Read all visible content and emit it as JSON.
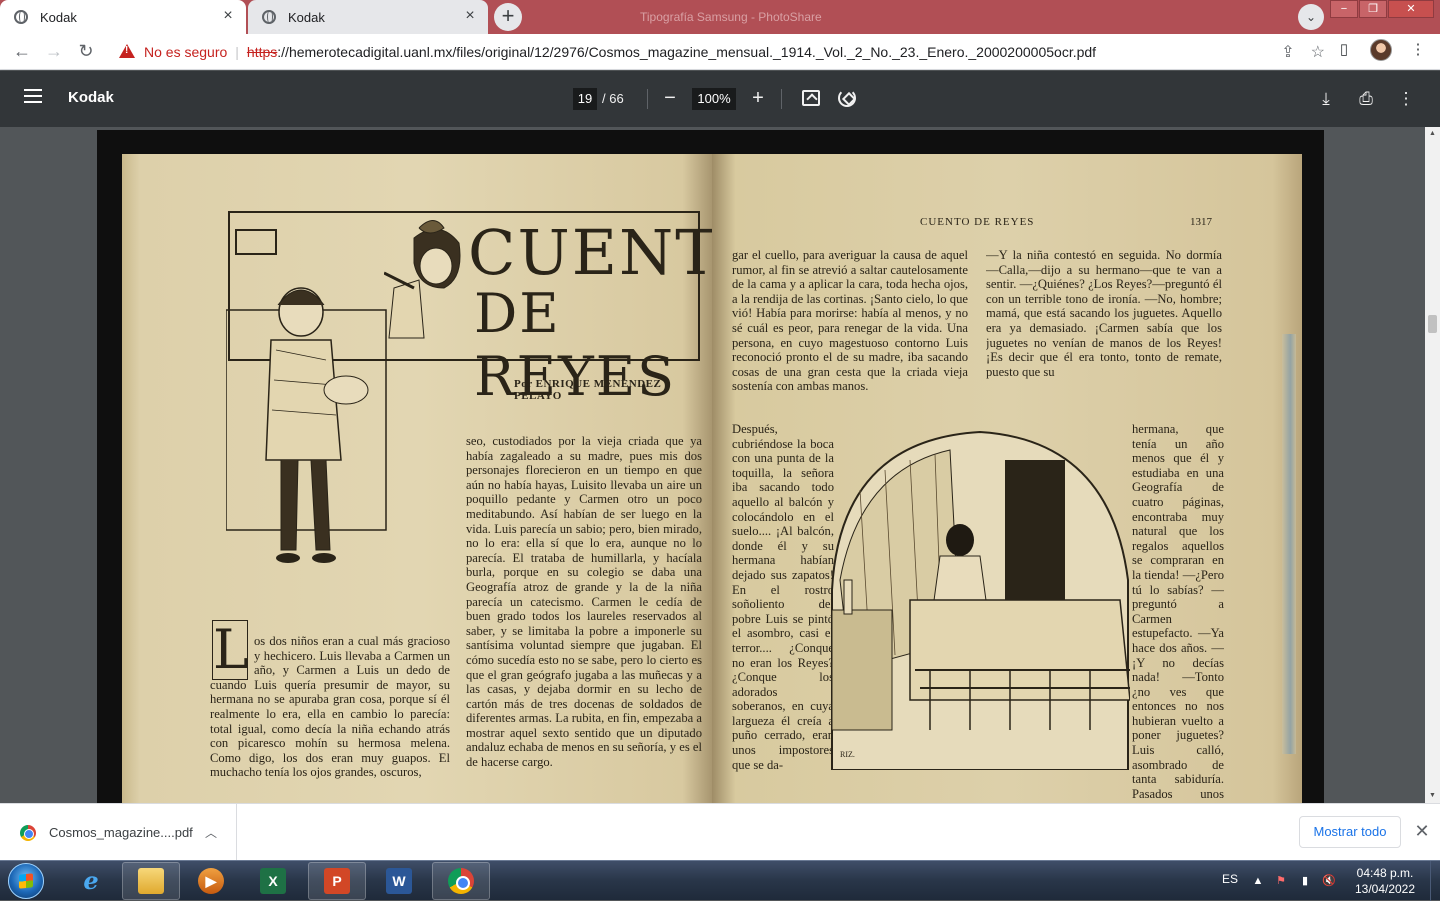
{
  "browser": {
    "tabs": [
      {
        "label": "Kodak",
        "active": true
      },
      {
        "label": "Kodak",
        "active": false
      }
    ],
    "new_tab_label": "+",
    "background_window_title": "Tipografía Samsung - PhotoShare",
    "window_buttons": {
      "minimize": "−",
      "maximize": "❐",
      "close": "✕"
    },
    "nav": {
      "back": "←",
      "forward": "→",
      "reload": "↻"
    },
    "security_label": "No es seguro",
    "url_scheme": "https",
    "url_rest": "://hemerotecadigital.uanl.mx/files/original/12/2976/Cosmos_magazine_mensual._1914._Vol._2_No._23._Enero._2000200005ocr.pdf"
  },
  "pdf_toolbar": {
    "title": "Kodak",
    "current_page": "19",
    "page_total": "/ 66",
    "zoom": "100%",
    "zoom_out": "−",
    "zoom_in": "+"
  },
  "document": {
    "running_head": "CUENTO DE REYES",
    "folio": "1317",
    "title_line1": "CUENTO",
    "title_line2": "DE REYES",
    "byline": "Por ENRIQUE MENENDEZ PELAYO",
    "dropcap": "L",
    "left_col1": "os dos niños eran a cual más gracioso y hechicero. Luis llevaba a Carmen un año, y Carmen a Luis un dedo de estatura. Así que cuando Luis quería presumir de mayor, su hermana no se apuraba gran cosa, porque sí él realmente lo era, ella en cambio lo parecía: total igual, como decía la niña echando atrás con picaresco mohín su hermosa melena. Como digo, los dos eran muy guapos. El muchacho tenía los ojos grandes, oscuros,",
    "left_col2": "seo, custodiados por la vieja criada que ya había zagaleado a su madre, pues mis dos personajes florecieron en un tiempo en que aún no había hayas, Luisito llevaba un aire un poquillo pedante y Carmen otro un poco meditabundo. Así habían de ser luego en la vida. Luis parecía un sabio; pero, bien mirado, no lo era: ella sí que lo era, aunque no lo parecía. El trataba de humillarla, y hacíala burla, porque en su colegio se daba una Geografía atroz de grande y la de la niña parecía un catecismo. Carmen le cedía de buen grado todos los laureles reservados al saber, y se limitaba la pobre a imponerle su santísima voluntad siempre que jugaban. El cómo sucedía esto no se sabe, pero lo cierto es que el gran geógrafo jugaba a las muñecas y a las casas, y dejaba dormir en su lecho de cartón más de tres docenas de soldados de diferentes armas. La rubita, en fin, empezaba a mostrar aquel sexto sentido que un diputado andaluz echaba de menos en su señoría, y es el de hacerse cargo.",
    "right_col1_top": "gar el cuello, para averiguar la causa de aquel rumor, al fin se atrevió a saltar cautelosamente de la cama y a aplicar la cara, toda hecha ojos, a la rendija de las cortinas. ¡Santo cielo, lo que vió! Había para morirse: había al menos, y no sé cuál es peor, para renegar de la vida. Una persona, en cuyo magestuoso contorno Luis reconoció pronto el de su madre, iba sacando cosas de una gran cesta que la criada vieja sostenía con ambas manos.",
    "right_col1_bottom": "Después, cubriéndose la boca con una punta de la toquilla, la señora iba sacando todo aquello al balcón y colocándolo en el suelo.... ¡Al balcón, donde él y su hermana habían dejado sus zapatos! En el rostro soñoliento del pobre Luis se pintó el asombro, casi el terror.... ¿Conque no eran los Reyes? ¿Conque los adorados soberanos, en cuya largueza él creía a puño cerrado, eran unos impostores que se da-",
    "right_col2_top": "—Y la niña contestó en seguida. No dormía —Calla,—dijo a su hermano—que te van a sentir. —¿Quiénes? ¿Los Reyes?—preguntó él con un terrible tono de ironía. —No, hombre; mamá, que está sacando los juguetes. Aquello era ya demasiado. ¡Carmen sabía que los juguetes no venían de manos de los Reyes! ¡Es decir que él era tonto, tonto de remate, puesto que su",
    "right_col2_bottom": "hermana, que tenía un año menos que él y estudiaba en una Geografía de cuatro páginas, encontraba muy natural que los regalos aquellos se compraran en la tienda! —¿Pero tú lo sabías? —preguntó a Carmen estupefacto. —Ya hace dos años. —¡Y no decías nada! —Tonto ¿no ves que entonces no nos hubieran vuelto a poner juguetes? Luis calló, asombrado de tanta sabiduría. Pasados unos momentos, expresó de este modo la síntesis de sus pensamientos:",
    "artist_mark": "RIZ."
  },
  "downloads": {
    "file_name": "Cosmos_magazine....pdf",
    "show_all": "Mostrar todo",
    "close": "✕"
  },
  "taskbar": {
    "apps": [
      "internet-explorer",
      "file-explorer",
      "media-player",
      "excel",
      "powerpoint",
      "word",
      "chrome"
    ],
    "app_glyphs": {
      "ie": "e",
      "excel": "X",
      "ppt": "P",
      "word": "W"
    },
    "language": "ES",
    "time": "04:48 p.m.",
    "date": "13/04/2022"
  },
  "colors": {
    "tab_strip": "#b14f55",
    "pdf_toolbar": "#323639",
    "viewer_background": "#525659",
    "paper": "#ddd0aa",
    "ink": "#2a2418",
    "link_blue": "#1a73e8",
    "insecure_red": "#c5221f"
  }
}
